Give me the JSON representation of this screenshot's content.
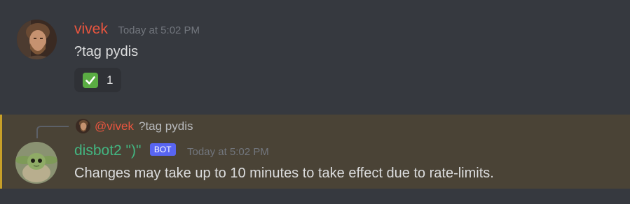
{
  "messages": [
    {
      "author": "vivek",
      "timestamp": "Today at 5:02 PM",
      "content": "?tag pydis",
      "reactions": [
        {
          "emoji": "white-check-mark",
          "count": "1"
        }
      ]
    },
    {
      "reply_to": {
        "mention": "@vivek",
        "content": "?tag pydis"
      },
      "author": "disbot2 \")\"",
      "tag": "BOT",
      "timestamp": "Today at 5:02 PM",
      "content": "Changes may take up to 10 minutes to take effect due to rate-limits."
    }
  ],
  "colors": {
    "background": "#36393f",
    "vivek_name": "#e8553f",
    "bot_name": "#43b581",
    "bot_tag": "#5865f2",
    "highlight_bg": "#4a4336",
    "highlight_bar": "#c8a028"
  }
}
